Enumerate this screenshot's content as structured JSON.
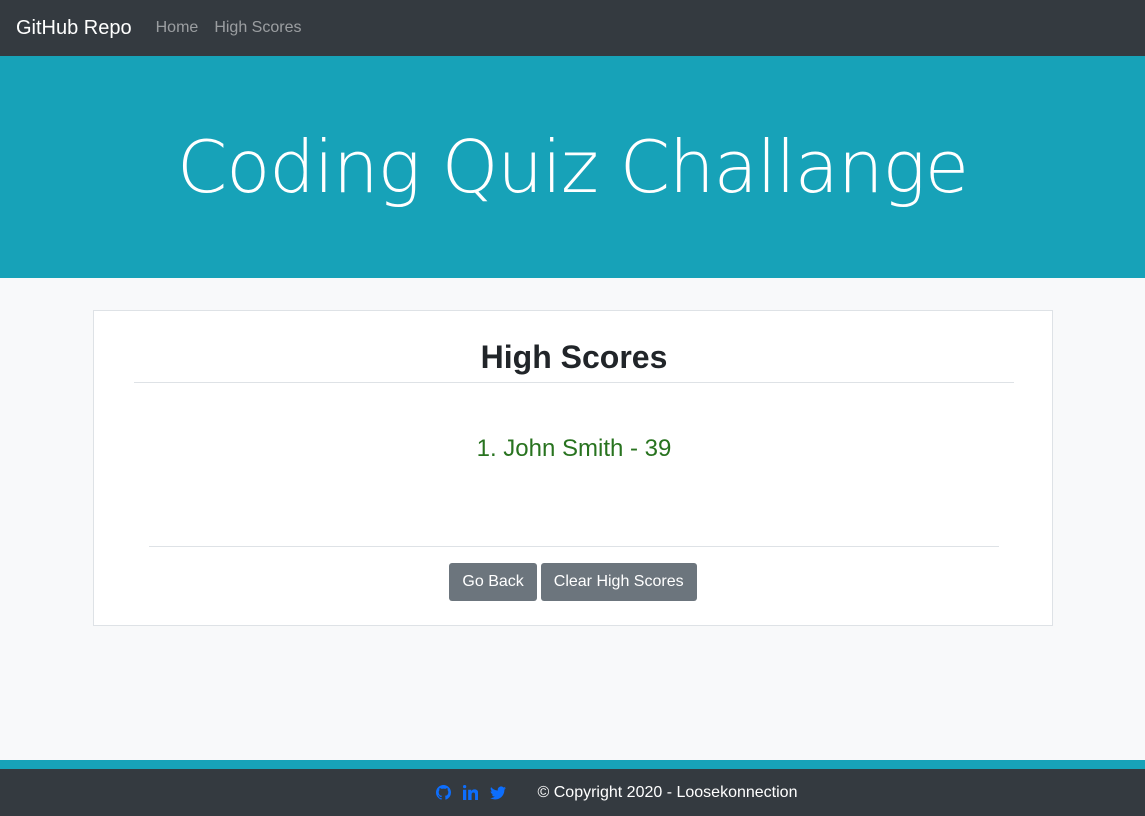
{
  "navbar": {
    "brand": "GitHub Repo",
    "links": [
      {
        "label": "Home"
      },
      {
        "label": "High Scores"
      }
    ]
  },
  "jumbotron": {
    "title": "Coding Quiz Challange"
  },
  "high_scores": {
    "title": "High Scores",
    "entries": [
      {
        "text": "1. John Smith - 39"
      }
    ],
    "score_color": "#28731f",
    "buttons": {
      "go_back": "Go Back",
      "clear": "Clear High Scores"
    }
  },
  "footer": {
    "icons": [
      "github-icon",
      "linkedin-icon",
      "twitter-icon"
    ],
    "icon_color": "#0d6efd",
    "copyright": "© Copyright 2020 - Loosekonnection"
  },
  "colors": {
    "navbar": "#343a40",
    "jumbotron": "#17a2b8",
    "button": "#6c757d",
    "page_bg": "#f8f9fa"
  }
}
